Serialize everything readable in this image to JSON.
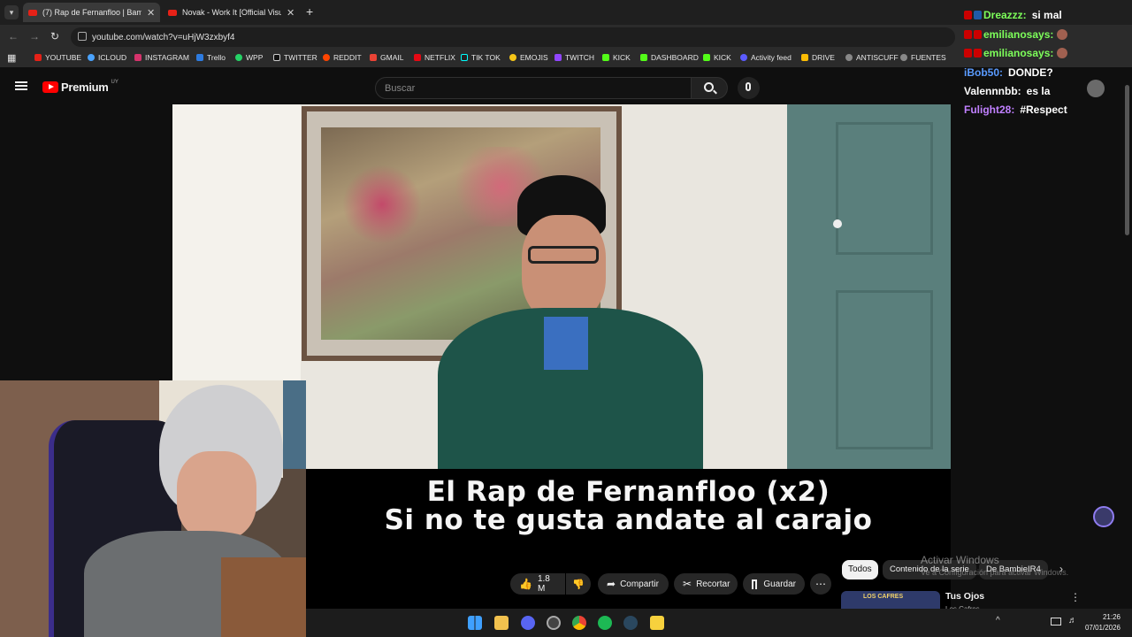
{
  "browser": {
    "tabs": [
      {
        "title": "(7) Rap de Fernanfloo | Bambie",
        "active": true
      },
      {
        "title": "Novak - Work It [Official Visual",
        "active": false
      }
    ],
    "url": "youtube.com/watch?v=uHjW3zxbyf4",
    "bookmarks": [
      "YOUTUBE",
      "ICLOUD",
      "INSTAGRAM",
      "Trello",
      "WPP",
      "TWITTER",
      "REDDIT",
      "GMAIL",
      "NETFLIX",
      "TIK TOK",
      "EMOJIS",
      "TWITCH",
      "KICK",
      "DASHBOARD",
      "KICK",
      "Activity feed",
      "DRIVE",
      "ANTISCUFF",
      "FUENTES"
    ]
  },
  "youtube": {
    "logo": "Premium",
    "region": "UY",
    "search_placeholder": "Buscar",
    "subtitle_line1": "El Rap de Fernanfloo (x2)",
    "subtitle_line2": "Si no te gusta andate al carajo",
    "likes": "1.8 M",
    "share": "Compartir",
    "clip": "Recortar",
    "save": "Guardar",
    "chips": [
      "Todos",
      "Contenido de la serie",
      "De BambieIR4"
    ],
    "reco_title": "Tus Ojos",
    "reco_channel": "Los Cafres",
    "reco_thumb_text": "LOS CAFRES"
  },
  "chat": [
    {
      "user": "Dreazzz:",
      "msg": "si mal",
      "color": "#7dff5a"
    },
    {
      "user": "emilianosays:",
      "msg": "",
      "color": "#7dff5a"
    },
    {
      "user": "emilianosays:",
      "msg": "",
      "color": "#7dff5a"
    },
    {
      "user": "iBob50:",
      "msg": "DONDE?",
      "color": "#5a9bff"
    },
    {
      "user": "Valennnbb:",
      "msg": "es la",
      "color": "#ffffff"
    },
    {
      "user": "Fulight28:",
      "msg": "#Respect",
      "color": "#c080ff"
    }
  ],
  "windows": {
    "watermark_title": "Activar Windows",
    "watermark_sub": "Ve a Configuración para activar Windows.",
    "time": "21:26",
    "date": "07/01/2026"
  }
}
